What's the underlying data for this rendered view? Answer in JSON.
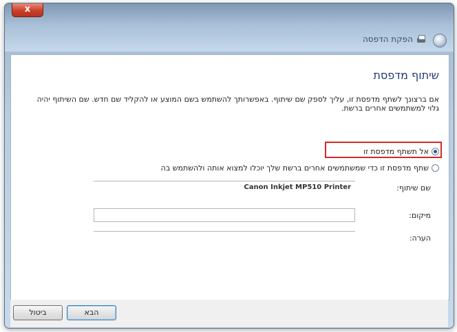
{
  "window": {
    "title": "הפקת הדפסה",
    "close_glyph": "x"
  },
  "page": {
    "title": "שיתוף מדפסת",
    "description": "אם ברצונך לשתף מדפסת זו, עליך לספק שם שיתוף. באפשרותך להשתמש בשם המוצע או להקליד שם חדש. שם השיתוף יהיה גלוי למשתמשים אחרים ברשת."
  },
  "options": {
    "no_share": {
      "label": "אל תשתף מדפסת זו",
      "selected": true
    },
    "share": {
      "label": "שתף מדפסת זו כדי שמשתמשים אחרים ברשת שלך יוכלו למצוא אותה ולהשתמש בה",
      "selected": false
    }
  },
  "fields": {
    "share_name": {
      "label": "שם שיתוף:",
      "value": "Canon Inkjet MP510 Printer"
    },
    "location": {
      "label": "מיקום:",
      "value": ""
    },
    "comment": {
      "label": "הערה:",
      "value": ""
    }
  },
  "buttons": {
    "next": "הבא",
    "cancel": "ביטול"
  },
  "colors": {
    "title_blue": "#1f3b73",
    "highlight_red": "#d12a25"
  }
}
